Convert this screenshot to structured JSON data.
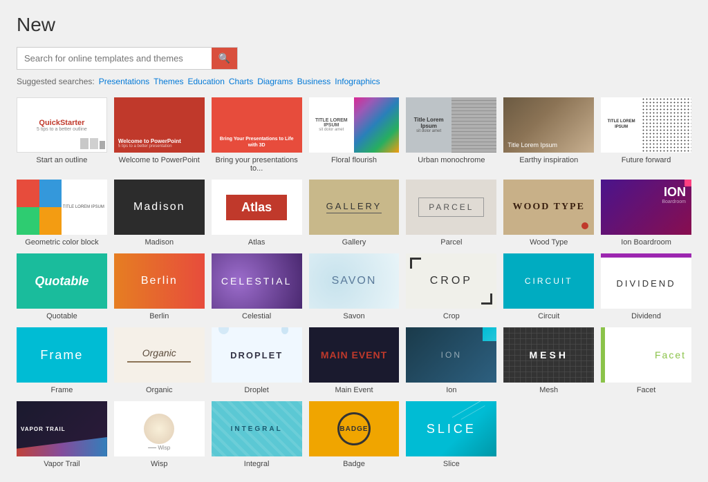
{
  "page": {
    "title": "New"
  },
  "search": {
    "placeholder": "Search for online templates and themes",
    "button_icon": "🔍"
  },
  "suggested": {
    "label": "Suggested searches:",
    "links": [
      "Presentations",
      "Themes",
      "Education",
      "Charts",
      "Diagrams",
      "Business",
      "Infographics"
    ]
  },
  "templates": [
    {
      "id": "quickstarter",
      "label": "Start an outline",
      "type": "quickstarter"
    },
    {
      "id": "welcome",
      "label": "Welcome to PowerPoint",
      "type": "welcome"
    },
    {
      "id": "bring",
      "label": "Bring your presentations to...",
      "type": "bring"
    },
    {
      "id": "floral",
      "label": "Floral flourish",
      "type": "floral"
    },
    {
      "id": "urban",
      "label": "Urban monochrome",
      "type": "urban"
    },
    {
      "id": "earthy",
      "label": "Earthy inspiration",
      "type": "earthy"
    },
    {
      "id": "future",
      "label": "Future forward",
      "type": "future"
    },
    {
      "id": "geometric",
      "label": "Geometric color block",
      "type": "geometric"
    },
    {
      "id": "madison",
      "label": "Madison",
      "type": "madison"
    },
    {
      "id": "atlas",
      "label": "Atlas",
      "type": "atlas"
    },
    {
      "id": "gallery",
      "label": "Gallery",
      "type": "gallery"
    },
    {
      "id": "parcel",
      "label": "Parcel",
      "type": "parcel"
    },
    {
      "id": "woodtype",
      "label": "Wood Type",
      "type": "woodtype"
    },
    {
      "id": "ion-boardroom",
      "label": "Ion Boardroom",
      "type": "ion"
    },
    {
      "id": "quotable",
      "label": "Quotable",
      "type": "quotable"
    },
    {
      "id": "berlin",
      "label": "Berlin",
      "type": "berlin"
    },
    {
      "id": "celestial",
      "label": "Celestial",
      "type": "celestial"
    },
    {
      "id": "savon",
      "label": "Savon",
      "type": "savon"
    },
    {
      "id": "crop",
      "label": "Crop",
      "type": "crop"
    },
    {
      "id": "circuit",
      "label": "Circuit",
      "type": "circuit"
    },
    {
      "id": "dividend",
      "label": "Dividend",
      "type": "dividend"
    },
    {
      "id": "frame",
      "label": "Frame",
      "type": "frame"
    },
    {
      "id": "organic",
      "label": "Organic",
      "type": "organic"
    },
    {
      "id": "droplet",
      "label": "Droplet",
      "type": "droplet"
    },
    {
      "id": "mainevent",
      "label": "Main Event",
      "type": "mainevent"
    },
    {
      "id": "ion",
      "label": "Ion",
      "type": "ion2"
    },
    {
      "id": "mesh",
      "label": "Mesh",
      "type": "mesh"
    },
    {
      "id": "facet",
      "label": "Facet",
      "type": "facet"
    },
    {
      "id": "vaportrail",
      "label": "Vapor Trail",
      "type": "vaportrail"
    },
    {
      "id": "wisp",
      "label": "Wisp",
      "type": "wisp"
    },
    {
      "id": "integral",
      "label": "Integral",
      "type": "integral"
    },
    {
      "id": "badge",
      "label": "Badge",
      "type": "badge"
    },
    {
      "id": "slice",
      "label": "Slice",
      "type": "slice"
    }
  ],
  "template_texts": {
    "quickstarter_title": "QuickStarter",
    "quickstarter_sub": "5 tips to a better outline",
    "welcome_text": "Welcome to PowerPoint",
    "bring_text": "Bring Your Presentations to Life with 3D",
    "floral_title": "TITLE LOREM IPSUM",
    "floral_subtitle": "sit dolor amet",
    "urban_title": "Title Lorem Ipsum",
    "urban_sub": "sit dolor amet",
    "earthy_text": "Title Lorem Ipsum",
    "future_title": "TITLE LOREM IPSUM",
    "geometric_text": "TITLE LOREM IPSUM",
    "madison_text": "Madison",
    "atlas_text": "Atlas",
    "gallery_text": "GALLERY",
    "parcel_text": "PARCEL",
    "woodtype_text": "WOOD TYPE",
    "ion_title": "ION",
    "ion_sub": "Boardroom",
    "quotable_text": "Quotable",
    "berlin_text": "Berlin",
    "celestial_text": "CELESTIAL",
    "savon_text": "SAVON",
    "crop_text": "CROP",
    "circuit_text": "CIRCUIT",
    "dividend_text": "DIVIDEND",
    "frame_text": "Frame",
    "organic_text": "Organic",
    "droplet_text": "DROPLET",
    "mainevent_text": "MAIN EVENT",
    "ion2_text": "ION",
    "mesh_text": "MESH",
    "facet_text": "Facet",
    "vaportrail_text": "VAPOR TRAIL",
    "wisp_text": "Wisp",
    "integral_text": "INTEGRAL",
    "badge_text": "BADGE",
    "slice_text": "SLICE"
  }
}
